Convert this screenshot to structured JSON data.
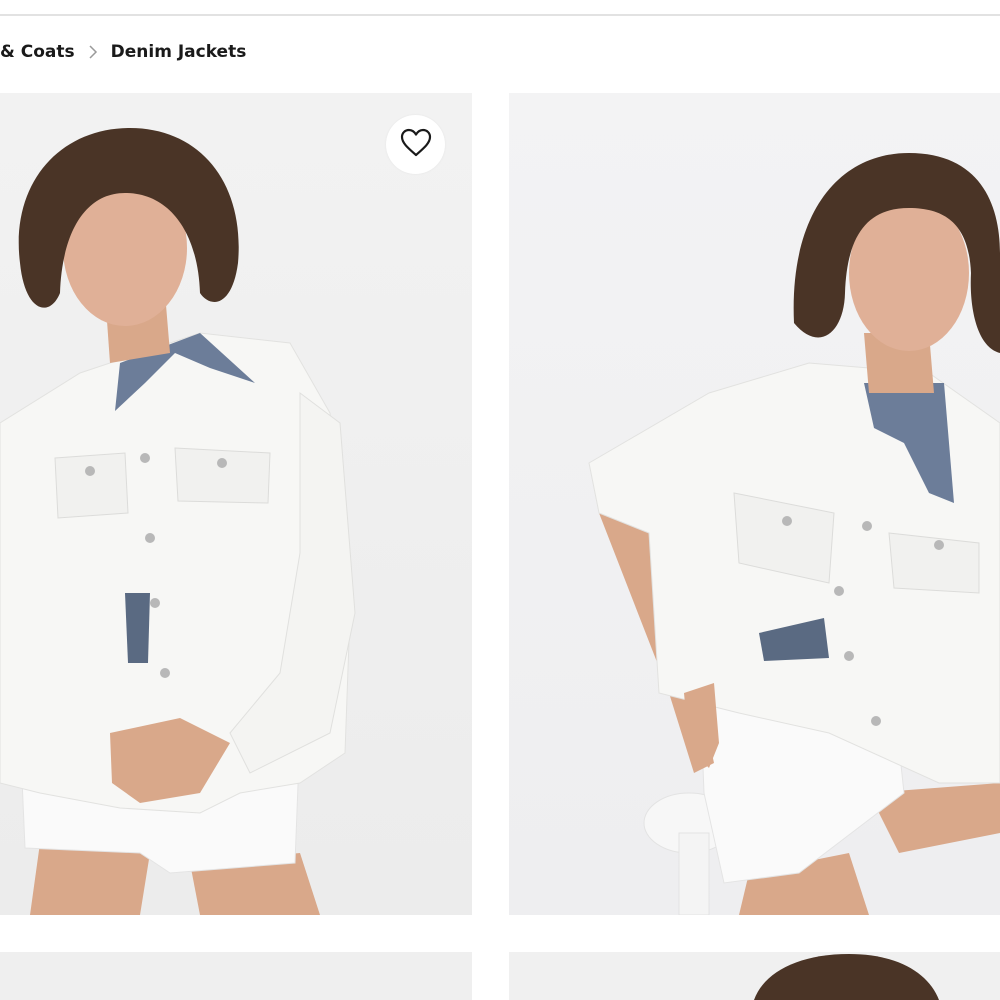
{
  "breadcrumb": {
    "parent_label": "& Coats",
    "current_label": "Denim Jackets",
    "separator_icon": "chevron-right-icon"
  },
  "products": [
    {
      "image_alt": "Model in white denim jacket, front view",
      "favorite_icon": "heart-outline-icon"
    },
    {
      "image_alt": "Model in white denim jacket, seated pose"
    },
    {
      "image_alt": "Product photo (partial)"
    },
    {
      "image_alt": "Product photo (partial)"
    }
  ],
  "colors": {
    "text": "#1a1a1a",
    "separator": "#9a9a9a",
    "photo_bg": "#efefef",
    "jacket": "#f7f7f5",
    "hair": "#4a3426",
    "skin": "#d9a88a"
  }
}
